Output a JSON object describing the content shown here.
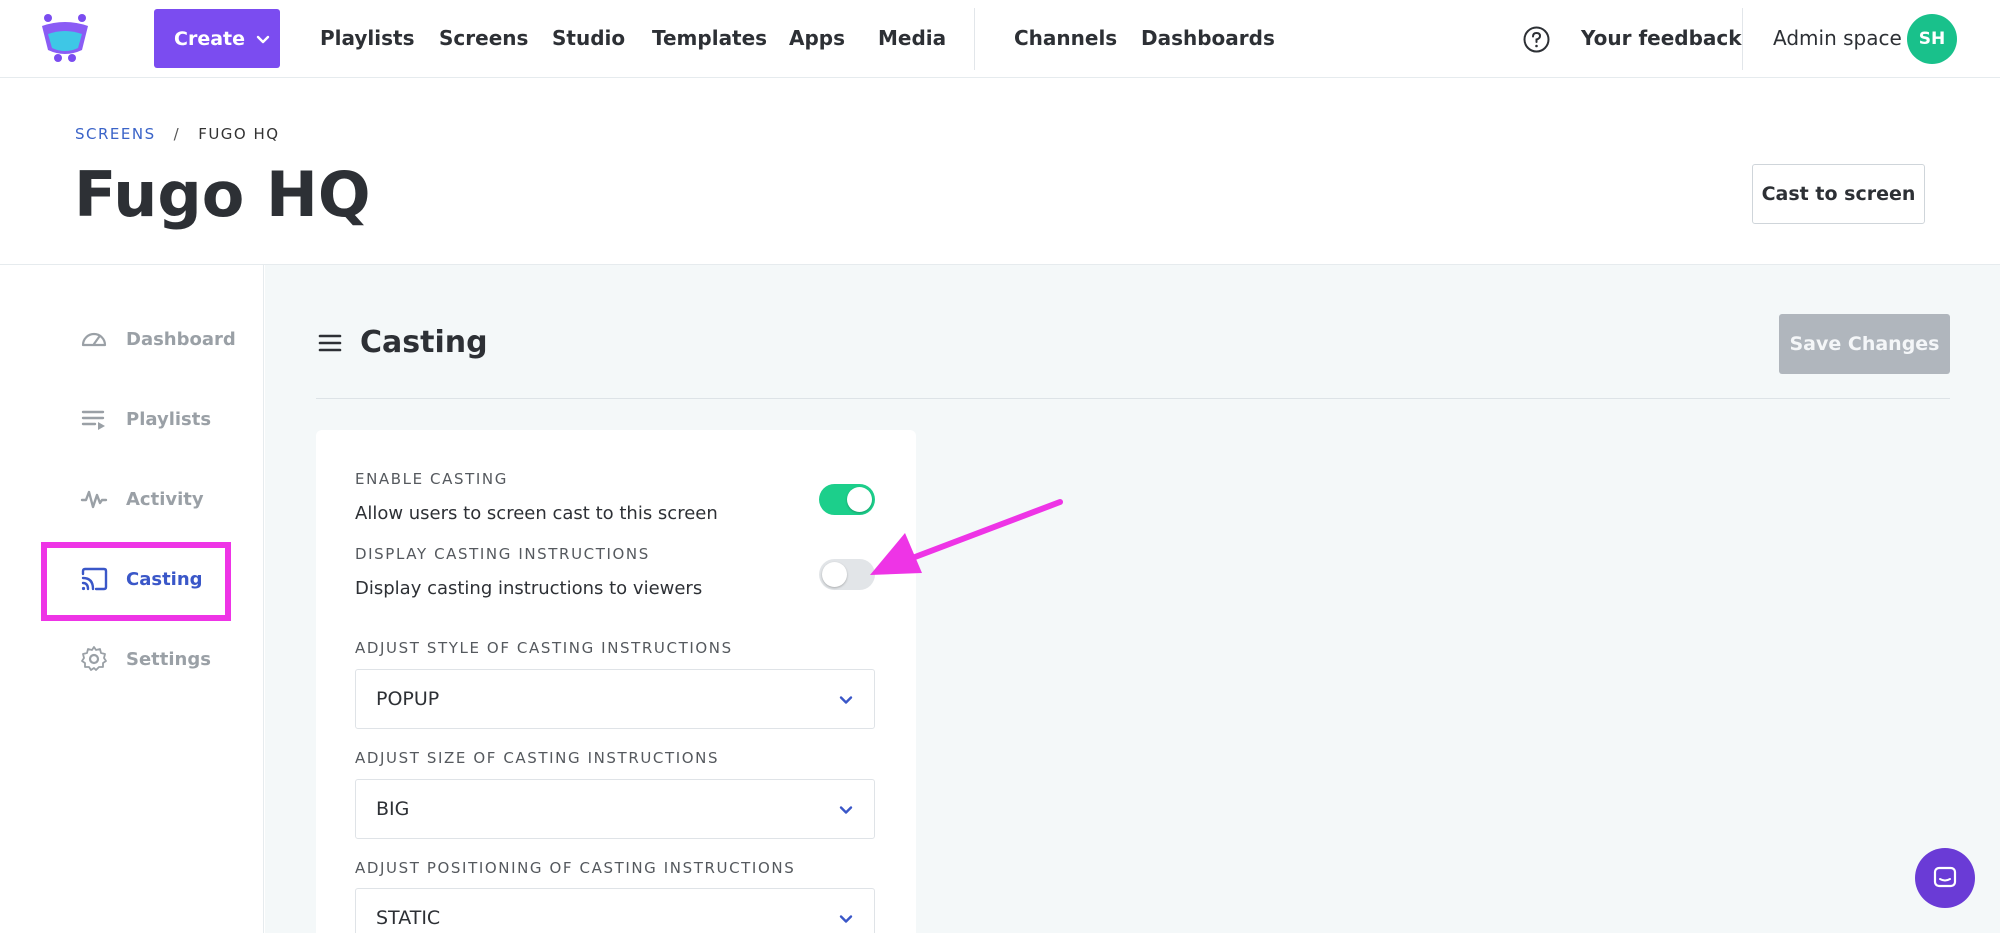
{
  "nav": {
    "create_label": "Create",
    "links": [
      "Playlists",
      "Screens",
      "Studio",
      "Templates",
      "Apps",
      "Media"
    ],
    "links_secondary": [
      "Channels",
      "Dashboards"
    ],
    "feedback_label": "Your feedback",
    "workspace_label": "Admin space",
    "avatar_initials": "SH",
    "accent_color": "#7b4cf0"
  },
  "header": {
    "breadcrumb": {
      "parent": "SCREENS",
      "separator": "/",
      "current": "FUGO HQ"
    },
    "title": "Fugo HQ",
    "cast_button": "Cast to screen"
  },
  "sidebar": {
    "items": [
      {
        "label": "Dashboard",
        "icon": "gauge-icon"
      },
      {
        "label": "Playlists",
        "icon": "playlist-icon"
      },
      {
        "label": "Activity",
        "icon": "activity-icon"
      },
      {
        "label": "Casting",
        "icon": "cast-icon",
        "active": true
      },
      {
        "label": "Settings",
        "icon": "gear-icon"
      }
    ]
  },
  "main": {
    "section_title": "Casting",
    "save_button": "Save Changes",
    "fields": {
      "enable_casting": {
        "label": "ENABLE CASTING",
        "description": "Allow users to screen cast to this screen",
        "enabled": true
      },
      "display_instructions": {
        "label": "DISPLAY CASTING INSTRUCTIONS",
        "description": "Display casting instructions to viewers",
        "enabled": false
      },
      "style": {
        "label": "ADJUST STYLE OF CASTING INSTRUCTIONS",
        "value": "POPUP"
      },
      "size": {
        "label": "ADJUST SIZE OF CASTING INSTRUCTIONS",
        "value": "BIG"
      },
      "positioning": {
        "label": "ADJUST POSITIONING OF CASTING INSTRUCTIONS",
        "value": "STATIC"
      }
    }
  },
  "annotation_color": "#ee34e6"
}
